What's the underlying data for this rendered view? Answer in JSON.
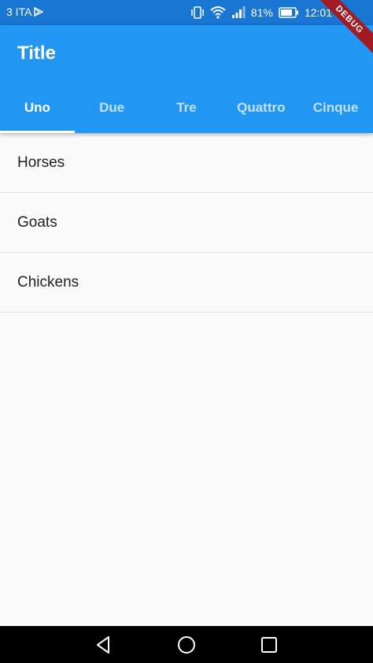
{
  "status_bar": {
    "carrier": "3 ITA",
    "battery": "81%",
    "time": "12:01",
    "icons": [
      "play-store-icon",
      "vibrate-icon",
      "wifi-icon",
      "signal-icon",
      "battery-icon"
    ]
  },
  "app_bar": {
    "title": "Title",
    "tabs": [
      {
        "label": "Uno",
        "active": true
      },
      {
        "label": "Due",
        "active": false
      },
      {
        "label": "Tre",
        "active": false
      },
      {
        "label": "Quattro",
        "active": false
      },
      {
        "label": "Cinque",
        "active": false
      }
    ]
  },
  "list": {
    "items": [
      {
        "label": "Horses"
      },
      {
        "label": "Goats"
      },
      {
        "label": "Chickens"
      }
    ]
  },
  "debug_banner": {
    "label": "DEBUG"
  },
  "nav_bar": {
    "icons": [
      "back-icon",
      "home-icon",
      "recents-icon"
    ]
  },
  "colors": {
    "status_bar": "#1976d2",
    "app_bar": "#2196f3",
    "background": "#fafafa",
    "debug_ribbon": "#a01b24"
  }
}
